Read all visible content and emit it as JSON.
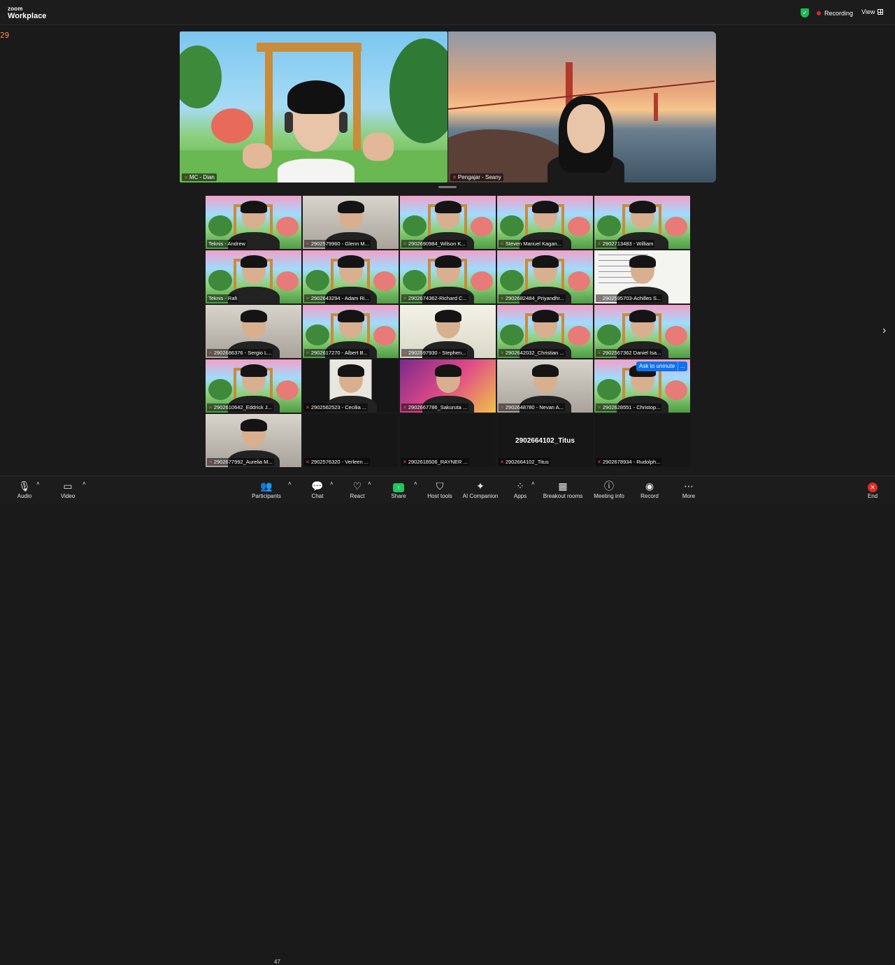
{
  "app": {
    "logo_line1": "zoom",
    "logo_line2": "Workplace"
  },
  "header": {
    "recording_label": "Recording",
    "view_label": "View"
  },
  "timer": "29",
  "spotlight": [
    {
      "name": "MC - Dian"
    },
    {
      "name": "Pengajar - Seany"
    }
  ],
  "gallery": [
    {
      "name": "Teknis - Andrew",
      "bg": "garden",
      "muted": false
    },
    {
      "name": "2902579960 - Glenn M...",
      "bg": "room",
      "muted": true
    },
    {
      "name": "2902690984_Wilson K...",
      "bg": "garden",
      "muted": true
    },
    {
      "name": "Steven Manuel Kagan...",
      "bg": "garden",
      "muted": true
    },
    {
      "name": "2902713483 - William",
      "bg": "garden",
      "muted": true
    },
    {
      "name": "Teknis - Rafi",
      "bg": "garden",
      "muted": false
    },
    {
      "name": "2902643294 - Adam Ri...",
      "bg": "garden",
      "muted": true
    },
    {
      "name": "2902674362-Richard C...",
      "bg": "garden",
      "muted": true
    },
    {
      "name": "2902682484_Priyandhr...",
      "bg": "garden",
      "muted": true
    },
    {
      "name": "2902595703-Achilles S...",
      "bg": "notes",
      "muted": true
    },
    {
      "name": "2902686376 - Sergio L...",
      "bg": "room",
      "muted": true
    },
    {
      "name": "2902617270 - Albert B...",
      "bg": "garden",
      "muted": true
    },
    {
      "name": "2902597930 - Stephen...",
      "bg": "white",
      "muted": true
    },
    {
      "name": "2902642032_Christian ...",
      "bg": "garden",
      "muted": true
    },
    {
      "name": "2902567362 Daniel Isa...",
      "bg": "garden",
      "muted": true
    },
    {
      "name": "2902610642_Eddrick J...",
      "bg": "garden",
      "muted": true
    },
    {
      "name": "2902562523 - Cecilia ...",
      "bg": "dark",
      "muted": true
    },
    {
      "name": "2902667786_Sakuruta ...",
      "bg": "anime",
      "muted": true
    },
    {
      "name": "2902648780 - Nevan A...",
      "bg": "room",
      "muted": true
    },
    {
      "name": "2902628551 - Christop...",
      "bg": "garden",
      "muted": true
    },
    {
      "name": "2902677992_Aurelia M...",
      "bg": "room",
      "muted": true
    },
    {
      "name": "2902576320 - Verleen ...",
      "bg": "dark",
      "muted": true
    },
    {
      "name": "2902618506_RAYNER ...",
      "bg": "dark",
      "muted": true
    },
    {
      "name": "2902664102_Titus",
      "bg": "dark",
      "muted": true,
      "center_label": "2902664102_Titus"
    },
    {
      "name": "2902678934 - Rudolph...",
      "bg": "dark",
      "muted": true
    }
  ],
  "ask_unmute": {
    "label": "Ask to unmute",
    "more": "..."
  },
  "toolbar": {
    "audio": "Audio",
    "video": "Video",
    "participants": "Participants",
    "participants_count": "47",
    "chat": "Chat",
    "react": "React",
    "share": "Share",
    "host_tools": "Host tools",
    "ai_companion": "AI Companion",
    "apps": "Apps",
    "breakout_rooms": "Breakout rooms",
    "meeting_info": "Meeting info",
    "record": "Record",
    "more": "More",
    "end": "End"
  },
  "colors": {
    "accent": "#0e72ed",
    "share_green": "#23c55e",
    "end_red": "#e02828",
    "mute_red": "#ff4d4d"
  }
}
